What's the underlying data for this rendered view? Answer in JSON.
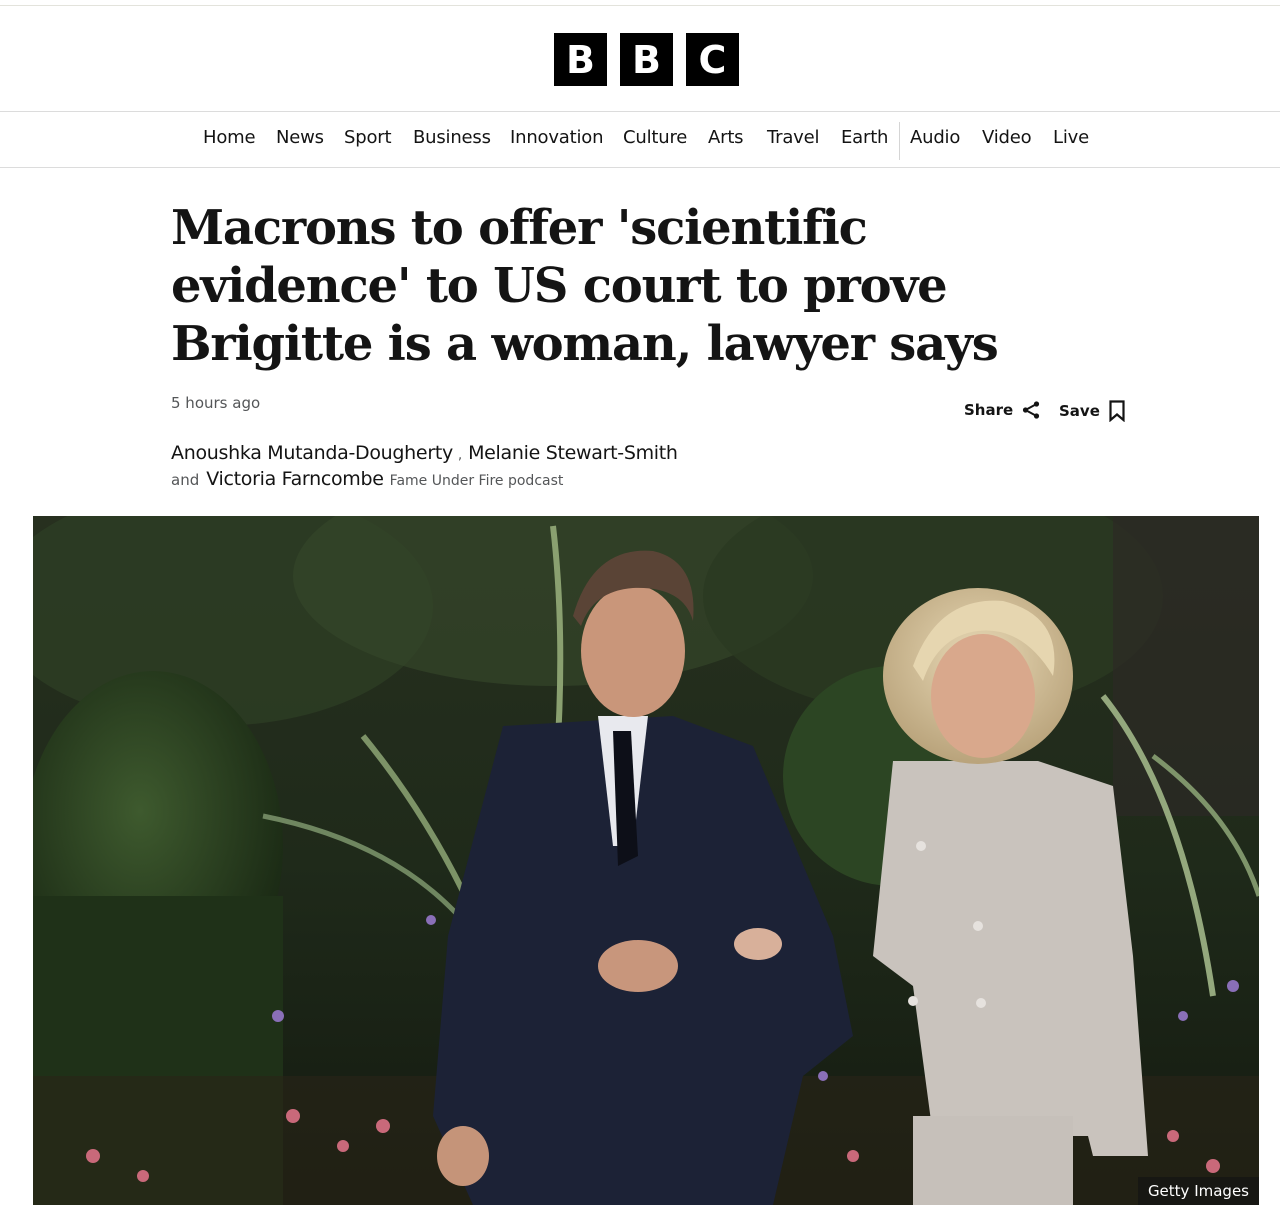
{
  "logo": {
    "letters": [
      "B",
      "B",
      "C"
    ]
  },
  "nav": {
    "items": [
      {
        "label": "Home"
      },
      {
        "label": "News"
      },
      {
        "label": "Sport"
      },
      {
        "label": "Business"
      },
      {
        "label": "Innovation"
      },
      {
        "label": "Culture"
      },
      {
        "label": "Arts"
      },
      {
        "label": "Travel"
      },
      {
        "label": "Earth"
      },
      {
        "label": "Audio"
      },
      {
        "label": "Video"
      },
      {
        "label": "Live"
      }
    ]
  },
  "article": {
    "headline": "Macrons to offer 'scientific evidence' to US court to prove Brigitte is a woman, lawyer says",
    "timestamp": "5 hours ago",
    "share_label": "Share",
    "save_label": "Save",
    "authors": [
      "Anoushka Mutanda-Dougherty",
      "Melanie Stewart-Smith",
      "Victoria Farncombe"
    ],
    "author_separator": ",",
    "conjunction": "and",
    "author_role": "Fame Under Fire podcast",
    "image_credit": "Getty Images"
  },
  "icons": {
    "share": "share-icon",
    "save": "bookmark-icon"
  }
}
